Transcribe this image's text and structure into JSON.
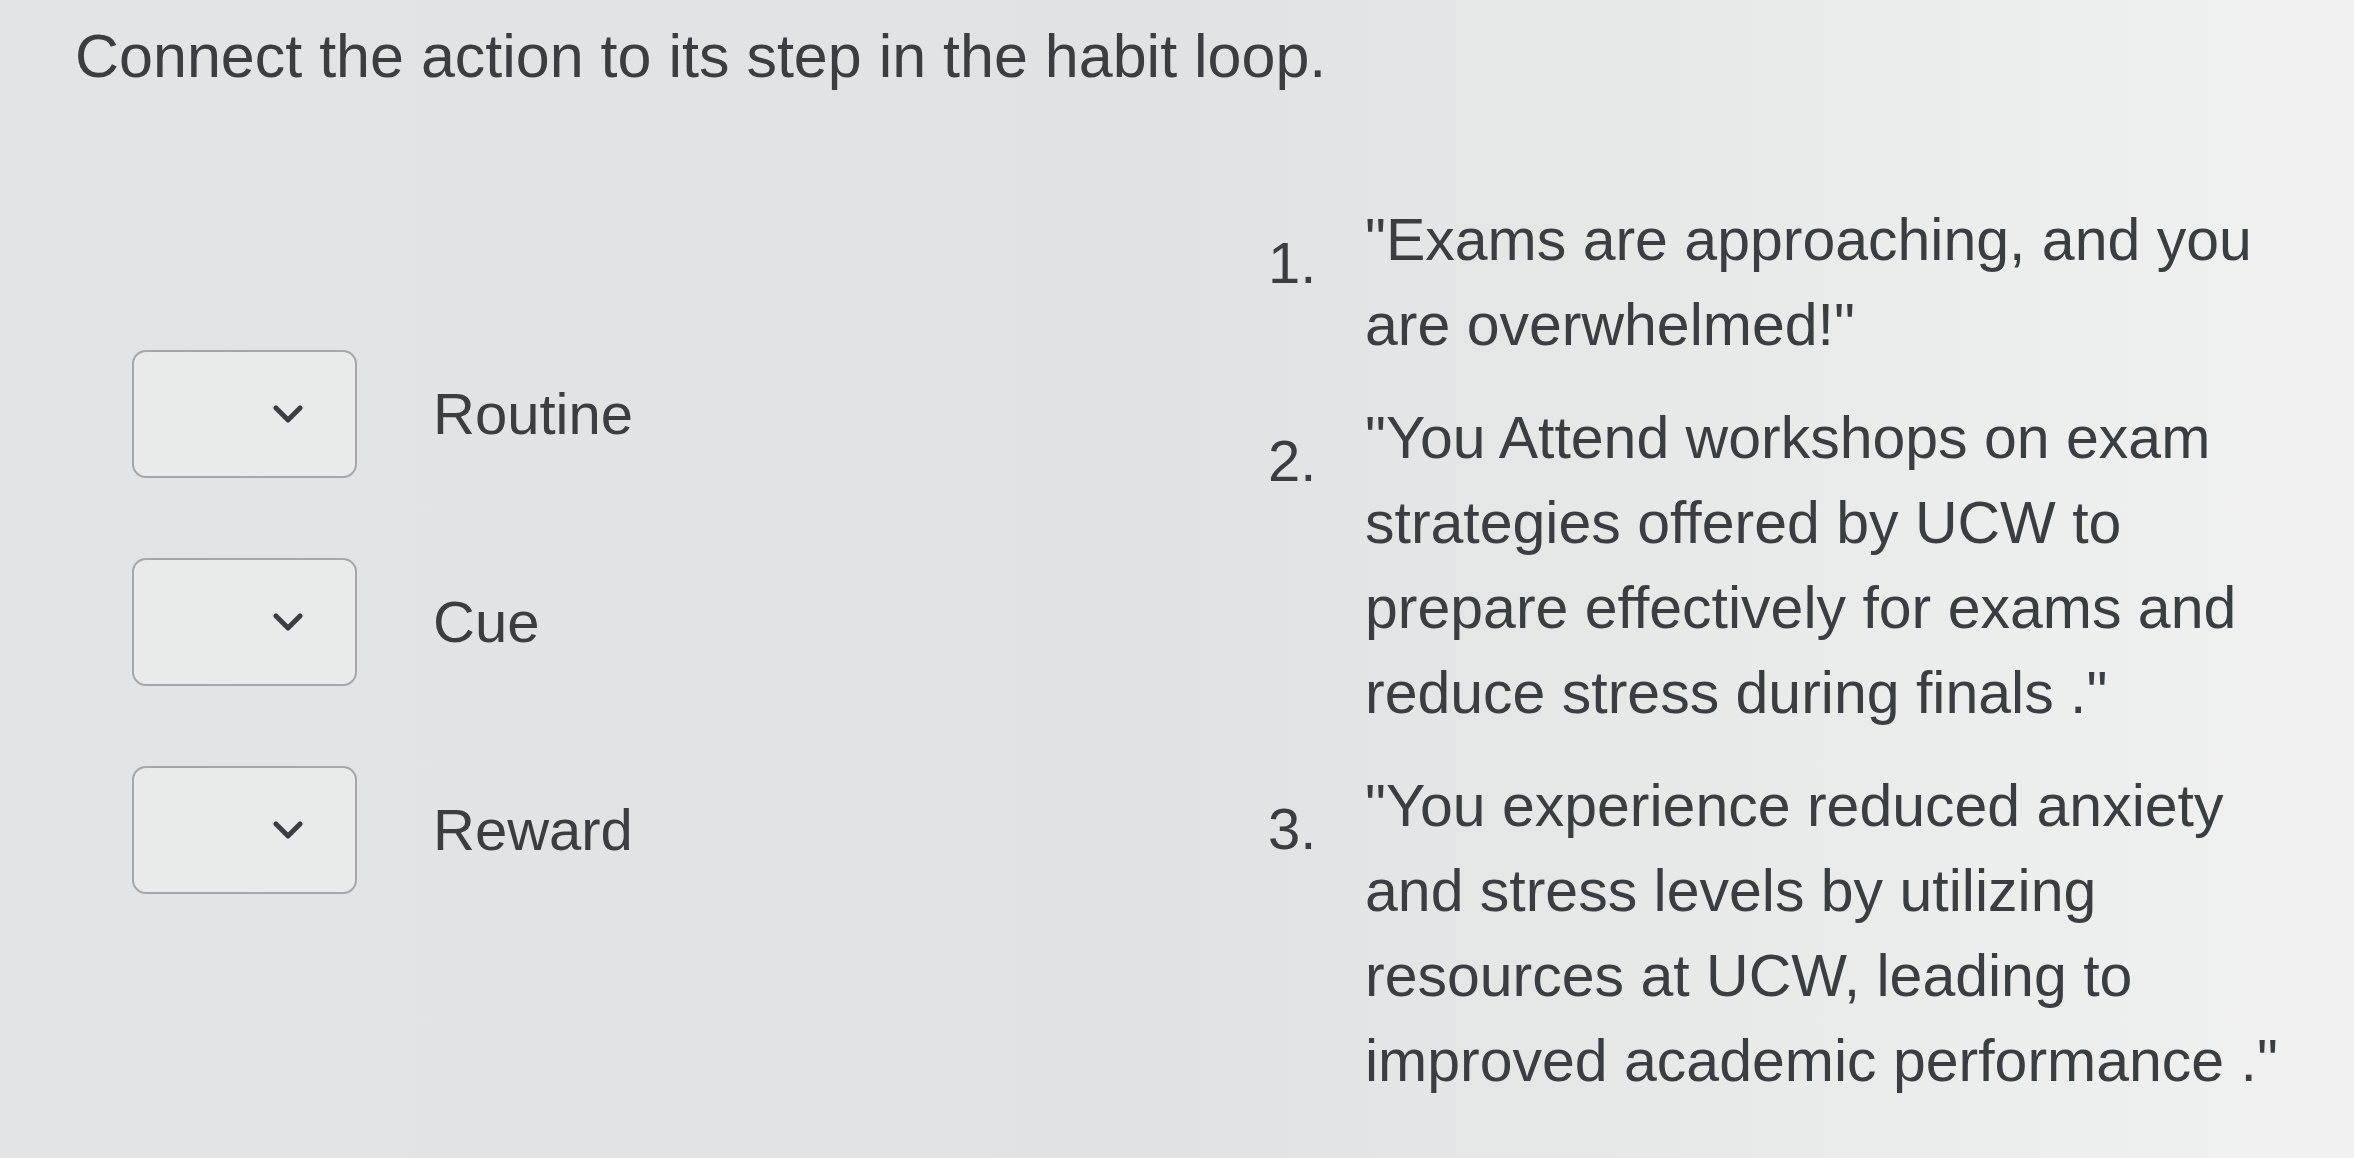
{
  "instruction": "Connect the action to its step in the habit loop.",
  "matches": [
    {
      "label": "Routine"
    },
    {
      "label": "Cue"
    },
    {
      "label": "Reward"
    }
  ],
  "options": [
    {
      "number": "1.",
      "text": "\"Exams are approaching, and you are overwhelmed!\""
    },
    {
      "number": "2.",
      "text": "\"You Attend workshops on exam strategies offered by UCW to prepare effectively for exams and reduce stress during finals .\""
    },
    {
      "number": "3.",
      "text": "\"You experience reduced anxiety and stress levels by utilizing resources at UCW, leading to improved academic performance .\""
    }
  ]
}
